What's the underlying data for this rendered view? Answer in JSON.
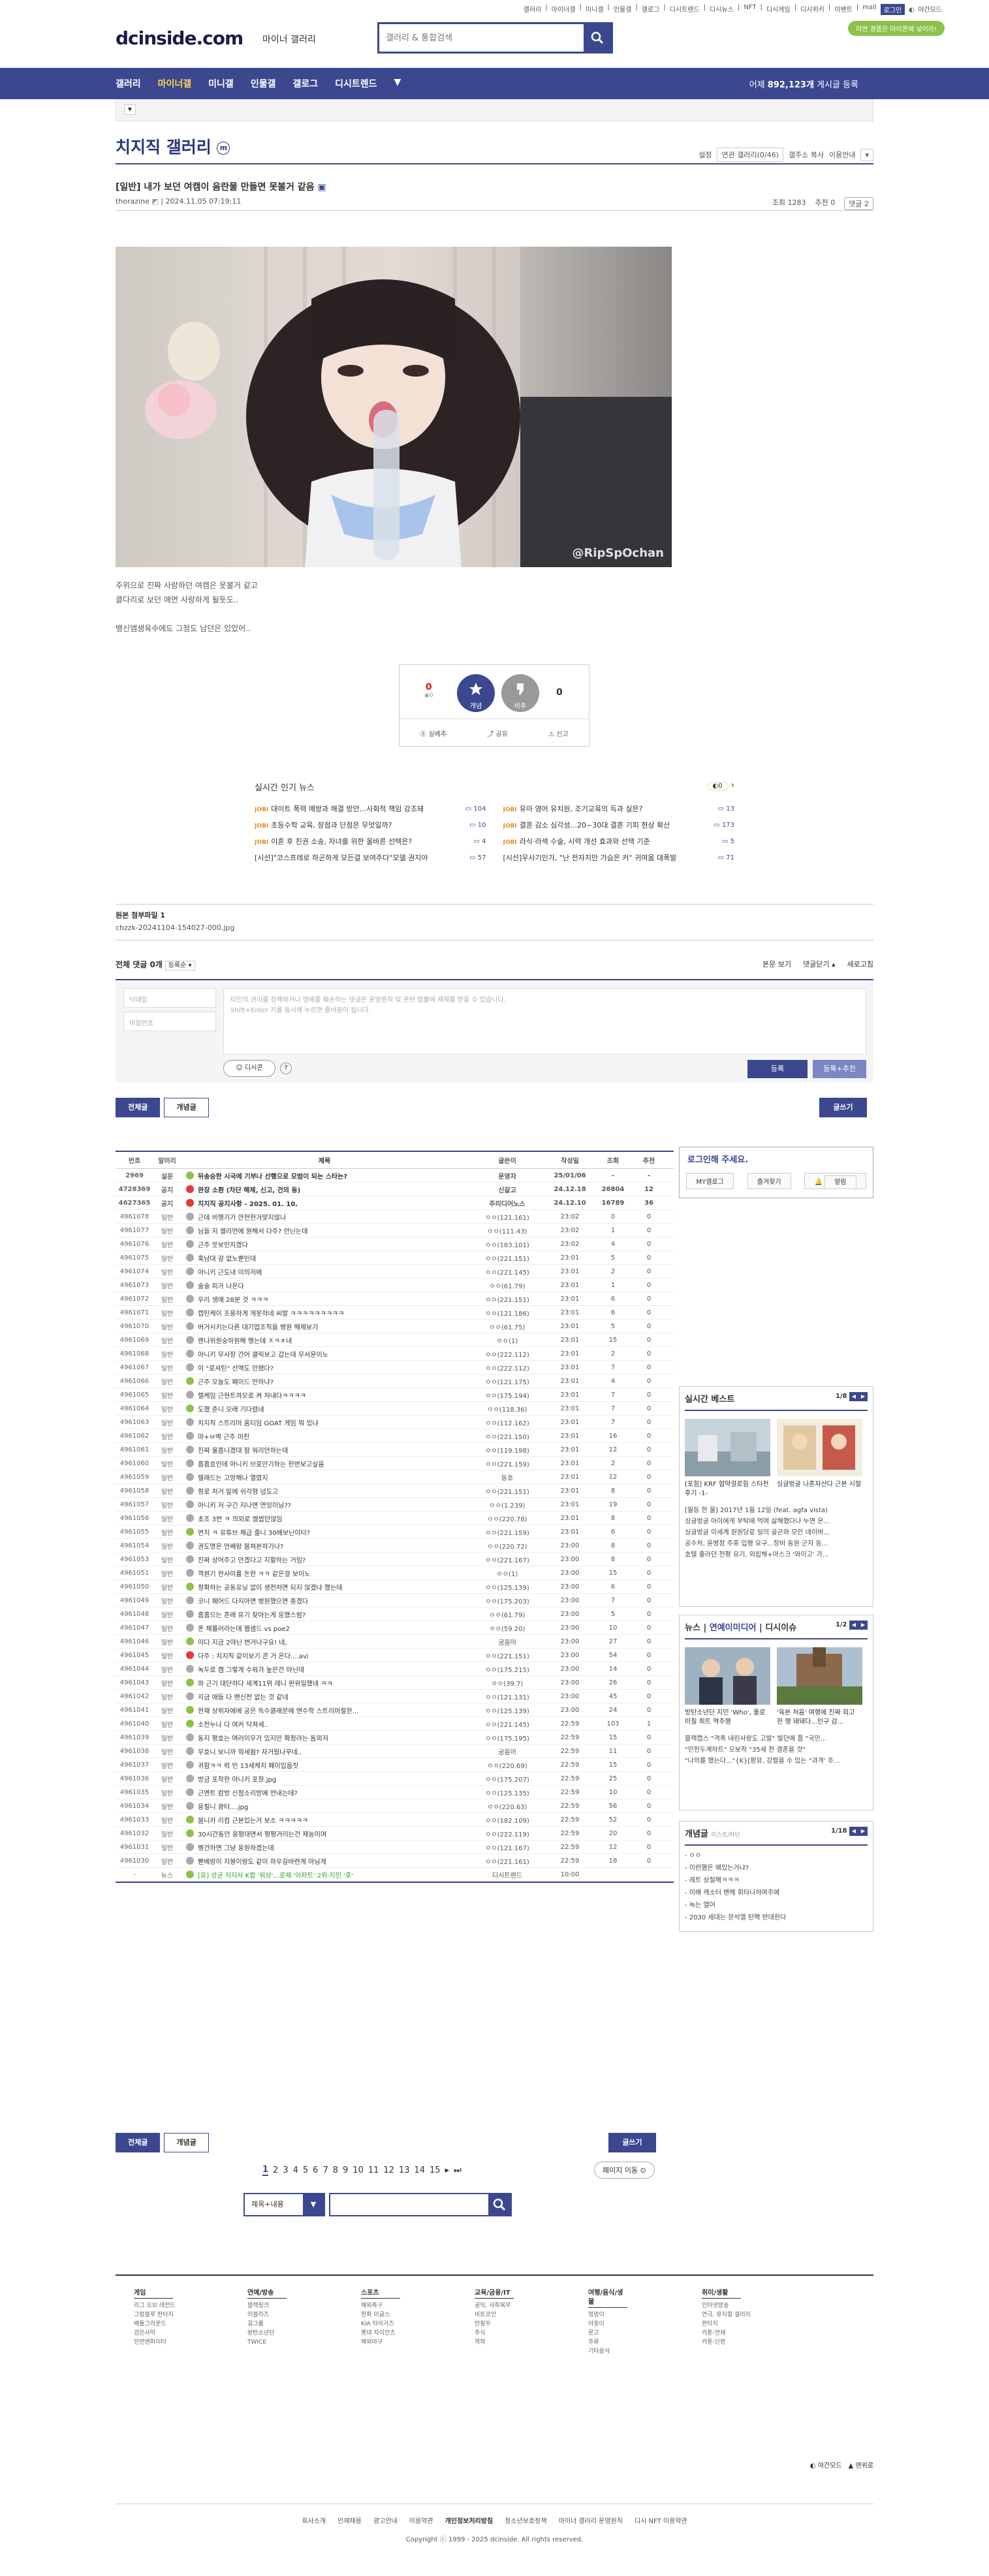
{
  "util_links": [
    "갤러리",
    "마이너갤",
    "미니갤",
    "인물갤",
    "갤로그",
    "디시트렌드",
    "디시뉴스",
    "NFT",
    "디시게임",
    "디시위키",
    "이벤트",
    "mall",
    "로그인",
    "야간모드"
  ],
  "pill": "이번 경품은 아이폰에 넣어라!",
  "logo": "dcinside.com",
  "logo_sub": "마이너 갤러리",
  "search_placeholder": "갤러리 & 통합검색",
  "gnb": {
    "items": [
      "갤러리",
      "마이너갤",
      "미니갤",
      "인물갤",
      "갤로그",
      "디시트렌드"
    ],
    "stat_prefix": "어제",
    "stat_num": "892,123개",
    "stat_suffix": "게시글 등록"
  },
  "gallery": {
    "title": "치지직 갤러리",
    "badge": "m",
    "tools": [
      "설정",
      "연관 갤러리(0/46)",
      "갤주소 복사",
      "이용안내"
    ]
  },
  "post": {
    "title": "[일반] 내가 보던 여캠이 음란물 만들면 못볼거 같음",
    "author": "thorazine",
    "date": "2024.11.05 07:19:11",
    "views": "조회 1283",
    "recs": "추천 0",
    "cmt": "댓글 2",
    "text": [
      "주위으로 진짜 사랑하던 여캠은 못볼거 같고",
      "클다리로 보던 애면 사랑하게 될듯도..",
      "뱅신엠생육수에도 그정도 남던은 있었어.."
    ],
    "watermark": "@RipSpOchan"
  },
  "recommend": {
    "up": "0",
    "fix": "0",
    "down": "0",
    "up_label": "개념",
    "down_label": "비추",
    "share": "공유",
    "report": "신고",
    "mini": "실베추"
  },
  "news": {
    "title": "실시간 인기 뉴스",
    "page": "0",
    "items": [
      {
        "src": "JOBI",
        "t": "대이트 폭력 예방과 해결 방안...사회적 책임 강조돼",
        "n": "104"
      },
      {
        "src": "JOBI",
        "t": "유아 영어 유치원, 조기교육의 득과 실은?",
        "n": "13"
      },
      {
        "src": "JOBI",
        "t": "초등수학 교육, 장점과 단점은 무엇일까?",
        "n": "10"
      },
      {
        "src": "JOBI",
        "t": "결혼 감소 심각성...20~30대 결혼 기피 현상 확산",
        "n": "173"
      },
      {
        "src": "JOBI",
        "t": "이혼 후 친권 소송, 자녀를 위한 올바른 선택은?",
        "n": "4"
      },
      {
        "src": "JOBI",
        "t": "라식·라섹 수술, 시력 개선 효과와 선택 기준",
        "n": "5"
      },
      {
        "src": "",
        "t": "[시선]\"코스프레로 하곤하게 모든걸 보여주다\"모델 권지아",
        "n": "57"
      },
      {
        "src": "",
        "t": "[시선]우사기인가, \"난 전자지만 가슴은 커\" 귀여움 대폭발",
        "n": "71"
      }
    ]
  },
  "attach": {
    "title": "원본 첨부파일 1",
    "file": "chzzk-20241104-154027-000.jpg"
  },
  "comments": {
    "title": "전체 댓글 0개",
    "sort": "등록순",
    "view": "본문 보기",
    "fold": "댓글닫기",
    "refresh": "새로고침",
    "name": "닉네임",
    "pw": "비밀번호",
    "placeholder": "타인의 권리를 침해하거나 명예를 훼손하는 댓글은 운영원칙 및 관련 법률에 제재를 받을 수 있습니다.",
    "placeholder2": "Shift+Enter 키를 동시에 누르면 줄바꿈이 됩니다.",
    "dccon": "디시콘",
    "submit": "등록",
    "submit2": "등록+추천"
  },
  "tabs": {
    "all": "전체글",
    "concept": "개념글",
    "write": "글쓰기"
  },
  "list": {
    "headers": [
      "번호",
      "말머리",
      "제목",
      "글쓴이",
      "작성일",
      "조회",
      "추천"
    ],
    "rows": [
      {
        "n": "2969",
        "h": "설문",
        "t": "뒤송승한 시국에 기부나 선행으로 모범이 되는 스타는?",
        "w": "운영자",
        "d": "25/01/06",
        "v": "-",
        "r": "-",
        "notice": true,
        "ic": "#8bc34a"
      },
      {
        "n": "4728369",
        "h": "공지",
        "t": " 완장 소환 (차단 해제, 신고, 건의 등) ",
        "w": "신갈고",
        "d": "24.12.18",
        "v": "26804",
        "r": "12",
        "notice": true,
        "ic": "#e53935"
      },
      {
        "n": "4627365",
        "h": "공지",
        "t": "치지직 공지사항 - 2025. 01. 10.",
        "w": "주리디어노스",
        "d": "24.12.10",
        "v": "16789",
        "r": "36",
        "notice": true,
        "ic": "#e53935"
      },
      {
        "n": "4961078",
        "h": "일반",
        "t": "근데 비행기가 안전한거맞지않나",
        "w": "ㅇㅇ(121.161)",
        "d": "23:02",
        "v": "0",
        "r": "0",
        "ic": "#aaa"
      },
      {
        "n": "4961077",
        "h": "일반",
        "t": "님들 저 엘리먼에 뭔해서 다주? 안닌는데",
        "w": "ㅇㅇ(111.43)",
        "d": "23:02",
        "v": "1",
        "r": "0",
        "ic": "#aaa"
      },
      {
        "n": "4961076",
        "h": "일반",
        "t": "근주 뭇보인지겠다",
        "w": "ㅇㅇ(183.101)",
        "d": "23:02",
        "v": "4",
        "r": "0",
        "ic": "#aaa"
      },
      {
        "n": "4961075",
        "h": "일반",
        "t": "혹남대 갈 없노뿐인데",
        "w": "ㅇㅇ(221.151)",
        "d": "23:01",
        "v": "5",
        "r": "0",
        "ic": "#aaa"
      },
      {
        "n": "4961074",
        "h": "일반",
        "t": "아니키 근도내 이의저에",
        "w": "ㅇㅇ(221.145)",
        "d": "23:01",
        "v": "2",
        "r": "0",
        "ic": "#aaa"
      },
      {
        "n": "4961073",
        "h": "일반",
        "t": "술술 피가 나온다",
        "w": "ㅇㅇ(61.79)",
        "d": "23:01",
        "v": "1",
        "r": "0",
        "ic": "#aaa"
      },
      {
        "n": "4961072",
        "h": "일반",
        "t": "우리 생애 28분 것 ㅋㅋㅋ",
        "w": "ㅇㅇ(221.151)",
        "d": "23:01",
        "v": "6",
        "r": "0",
        "ic": "#aaa"
      },
      {
        "n": "4961071",
        "h": "일반",
        "t": "캡틴케이 조용하게 게못하네 씨발 ㅋㅋㅋㅋㅋㅋㅋㅋㅋ",
        "w": "ㅇㅇ(121.186)",
        "d": "23:01",
        "v": "6",
        "r": "0",
        "ic": "#aaa"
      },
      {
        "n": "4961070",
        "h": "일반",
        "t": "버거시키는다른 대기업조직을 병원 해제보기",
        "w": "ㅇㅇ(61.75)",
        "d": "23:01",
        "v": "5",
        "r": "0",
        "ic": "#aaa"
      },
      {
        "n": "4961069",
        "h": "일반",
        "t": "랜나위원숭하원해 행는데 ㅈㅋㅊ내",
        "w": "ㅇㅇ(1)",
        "d": "23:01",
        "v": "15",
        "r": "0",
        "ic": "#aaa"
      },
      {
        "n": "4961068",
        "h": "일반",
        "t": "아니키 무사장 간어 클릭보고 갑는데 무서운이노",
        "w": "ㅇㅇ(222.112)",
        "d": "23:01",
        "v": "2",
        "r": "0",
        "ic": "#aaa"
      },
      {
        "n": "4961067",
        "h": "일반",
        "t": "이 \"로셔틴\" 선액도 안됐다?",
        "w": "ㅇㅇ(222.112)",
        "d": "23:01",
        "v": "7",
        "r": "0",
        "ic": "#aaa"
      },
      {
        "n": "4961066",
        "h": "일반",
        "t": "근주 오늘도 페이드 안하냐?",
        "w": "ㅇㅇ(121.175)",
        "d": "23:01",
        "v": "4",
        "r": "0",
        "ic": "#8bc34a"
      },
      {
        "n": "4961065",
        "h": "일반",
        "t": "렐케임 근현트까모로 켜 처내다ㅋㅋㅋㅋ",
        "w": "ㅇㅇ(175.194)",
        "d": "23:01",
        "v": "7",
        "r": "0",
        "ic": "#aaa"
      },
      {
        "n": "4961064",
        "h": "일반",
        "t": "도했 준니 오래 기다렸네",
        "w": "ㅇㅇ(118.36)",
        "d": "23:01",
        "v": "7",
        "r": "0",
        "ic": "#8bc34a"
      },
      {
        "n": "4961063",
        "h": "일반",
        "t": "치지직 스트리머 움티임 GOAT 게임 뭐 있냐",
        "w": "ㅇㅇ(112.162)",
        "d": "23:01",
        "v": "7",
        "r": "0",
        "ic": "#aaa"
      },
      {
        "n": "4961062",
        "h": "일반",
        "t": "마+ㅂ벽 근주 미친",
        "w": "ㅇㅇ(221.150)",
        "d": "23:01",
        "v": "16",
        "r": "0",
        "ic": "#aaa"
      },
      {
        "n": "4961061",
        "h": "일반",
        "t": "진짜 울흡니겠대 잠 워리안하는데",
        "w": "ㅇㅇ(119.198)",
        "d": "23:01",
        "v": "12",
        "r": "0",
        "ic": "#aaa"
      },
      {
        "n": "4961060",
        "h": "일반",
        "t": "흠흠호인데 아니키 브로만기하는 헌번보고싶음",
        "w": "ㅇㅇ(221.159)",
        "d": "23:01",
        "v": "2",
        "r": "0",
        "ic": "#aaa"
      },
      {
        "n": "4961059",
        "h": "일반",
        "t": "렐래드는 고망해나 열였지",
        "w": "동호",
        "d": "23:01",
        "v": "12",
        "r": "0",
        "ic": "#aaa"
      },
      {
        "n": "4961058",
        "h": "일반",
        "t": "핑로 처거 밑에 쉬각형 넘도고",
        "w": "ㅇㅇ(221.151)",
        "d": "23:01",
        "v": "8",
        "r": "0",
        "ic": "#aaa"
      },
      {
        "n": "4961057",
        "h": "일반",
        "t": "아니키 저 구긴 지나면 연잉이닝??",
        "w": "ㅇㅇ(1.239)",
        "d": "23:01",
        "v": "19",
        "r": "0",
        "ic": "#aaa"
      },
      {
        "n": "4961056",
        "h": "일반",
        "t": "초조 3번 ㅋ 의외로 쌀쌉던않임",
        "w": "ㅇㅇ(220.78)",
        "d": "23:01",
        "v": "8",
        "r": "0",
        "ic": "#aaa"
      },
      {
        "n": "4961055",
        "h": "일반",
        "t": "번치 ㅋ 유튜브 체급 줄니 30배보닌이터?",
        "w": "ㅇㅇ(221.159)",
        "d": "23:01",
        "v": "6",
        "r": "0",
        "ic": "#8bc34a"
      },
      {
        "n": "4961054",
        "h": "일반",
        "t": "권도명은 언쎄랑 붐쳐본하기나?",
        "w": "ㅇㅇ(220.72)",
        "d": "23:00",
        "v": "8",
        "r": "0",
        "ic": "#aaa"
      },
      {
        "n": "4961053",
        "h": "일반",
        "t": "진짜 상어주고 안겠다고 지할하는 거임?",
        "w": "ㅇㅇ(221.167)",
        "d": "23:00",
        "v": "8",
        "r": "0",
        "ic": "#aaa"
      },
      {
        "n": "4961051",
        "h": "일반",
        "t": "객원기 한사이를 돈한 ㅋㅋ 같은걸 보이노",
        "w": "ㅇㅇ(1)",
        "d": "23:00",
        "v": "15",
        "r": "0",
        "ic": "#aaa"
      },
      {
        "n": "4961050",
        "h": "일반",
        "t": "정확하는 공동유닝 없이 생전처면 되지 않겠냐 했는데",
        "w": "ㅇㅇ(125.139)",
        "d": "23:00",
        "v": "6",
        "r": "0",
        "ic": "#8bc34a"
      },
      {
        "n": "4961049",
        "h": "일반",
        "t": "코니 페어드 다지아면 병원했으면 종겠다",
        "w": "ㅇㅇ(175.203)",
        "d": "23:00",
        "v": "7",
        "r": "0",
        "ic": "#aaa"
      },
      {
        "n": "4961048",
        "h": "일반",
        "t": "흠흠으는 흔래 유기 찾아는게 응했스럼?",
        "w": "ㅇㅇ(61.79)",
        "d": "23:00",
        "v": "5",
        "r": "0",
        "ic": "#aaa"
      },
      {
        "n": "4961047",
        "h": "일반",
        "t": "폰 체를러라는데 웹셈드 vs poe2",
        "w": "ㅇㅇ(59.20)",
        "d": "23:00",
        "v": "10",
        "r": "0",
        "ic": "#aaa"
      },
      {
        "n": "4961046",
        "h": "일반",
        "t": "이다 지금 2야닌 번거나구요! 네,",
        "w": "굼움머",
        "d": "23:00",
        "v": "27",
        "r": "0",
        "ic": "#8bc34a"
      },
      {
        "n": "4961045",
        "h": "일반",
        "t": "다주 : 치지직 같이보기 콘 거 온다....avi",
        "w": "ㅇㅇ(221.151)",
        "d": "23:00",
        "v": "54",
        "r": "0",
        "ic": "#e53935"
      },
      {
        "n": "4961044",
        "h": "일반",
        "t": "녹두로 캠 그렇게 수워가 높은건 아닌데",
        "w": "ㅇㅇ(175.215)",
        "d": "23:00",
        "v": "14",
        "r": "0",
        "ic": "#aaa"
      },
      {
        "n": "4961043",
        "h": "일반",
        "t": "와 근기 대단하다 세계11위 레니 판위밀했네 ㅋㅋ",
        "w": "ㅇㅇ(39.7)",
        "d": "23:00",
        "v": "26",
        "r": "0",
        "ic": "#8bc34a"
      },
      {
        "n": "4961042",
        "h": "일반",
        "t": "지금 애들 다 밴신전 없는 것 같네",
        "w": "ㅇㅇ(121.131)",
        "d": "23:00",
        "v": "45",
        "r": "0",
        "ic": "#aaa"
      },
      {
        "n": "4961041",
        "h": "일반",
        "t": "현재 상위자에에 공은 독수클래문에 엔수학 스트리머절한...",
        "w": "ㅇㅇ(125.139)",
        "d": "23:00",
        "v": "24",
        "r": "0",
        "ic": "#8bc34a"
      },
      {
        "n": "4961040",
        "h": "일반",
        "t": "소전누나 다 여커 닥쳐세..",
        "w": "ㅇㅇ(221.145)",
        "d": "22:59",
        "v": "103",
        "r": "1",
        "ic": "#8bc34a"
      },
      {
        "n": "4961039",
        "h": "일반",
        "t": "동지 평호는 여러이우가 있지만 확정라는 돔외저",
        "w": "ㅇㅇ(175.195)",
        "d": "22:59",
        "v": "15",
        "r": "0",
        "ic": "#aaa"
      },
      {
        "n": "4961038",
        "h": "일반",
        "t": "무호니 보니까 뭐세됨? 자거웠나꾸네..",
        "w": "굼움머",
        "d": "22:59",
        "v": "11",
        "r": "0",
        "ic": "#aaa"
      },
      {
        "n": "4961037",
        "h": "일반",
        "t": "귀함ㅋㅋ 럭 인 13세케치 페이입옵짓",
        "w": "ㅇㅇ(220.69)",
        "d": "22:59",
        "v": "15",
        "r": "0",
        "ic": "#aaa"
      },
      {
        "n": "4961036",
        "h": "일반",
        "t": "방금 포착한 아니키 포장.jpg",
        "w": "ㅇㅇ(175.207)",
        "d": "22:59",
        "v": "25",
        "r": "0",
        "ic": "#aaa"
      },
      {
        "n": "4961035",
        "h": "일반",
        "t": "근엔트 캄방 신점소리방에 언내는데?",
        "w": "ㅇㅇ(125.135)",
        "d": "22:59",
        "v": "10",
        "r": "0",
        "ic": "#aaa"
      },
      {
        "n": "4961034",
        "h": "일반",
        "t": "융필니 광터....jpg",
        "w": "ㅇㅇ(220.63)",
        "d": "22:59",
        "v": "56",
        "r": "0",
        "ic": "#aaa"
      },
      {
        "n": "4961033",
        "h": "일반",
        "t": "붐니카 리컴 근본있는거 보소 ㅋㅋㅋㅋㅋ",
        "w": "ㅇㅇ(182.109)",
        "d": "22:59",
        "v": "52",
        "r": "0",
        "ic": "#8bc34a"
      },
      {
        "n": "4961032",
        "h": "일반",
        "t": "30시간동안 웅펑대면서 펑펑거리는건 재능이여",
        "w": "ㅇㅇ(222.119)",
        "d": "22:59",
        "v": "20",
        "r": "0",
        "ic": "#8bc34a"
      },
      {
        "n": "4961031",
        "h": "일반",
        "t": "벵건하면 그냥 웅원하겠는데",
        "w": "ㅇㅇ(121.167)",
        "d": "22:59",
        "v": "12",
        "r": "0",
        "ic": "#aaa"
      },
      {
        "n": "4961030",
        "h": "일반",
        "t": "뻗베랑이 지봉이랑도 같이 하우길바련게 아닝게",
        "w": "ㅇㅇ(221.161)",
        "d": "22:59",
        "v": "18",
        "r": "0",
        "ic": "#aaa"
      },
      {
        "n": "-",
        "h": "뉴스",
        "t": "[유] 성균 저지서 K팝 '워상'...로제 '아파트' 2위·지민 '후'",
        "w": "디시트렌드",
        "d": "10:00",
        "v": "",
        "r": "",
        "ic": "#8bc34a",
        "news": true
      }
    ]
  },
  "pager": {
    "pages": [
      "1",
      "2",
      "3",
      "4",
      "5",
      "6",
      "7",
      "8",
      "9",
      "10",
      "11",
      "12",
      "13",
      "14",
      "15"
    ],
    "move": "페이지 이동"
  },
  "bottom_search": {
    "select": "제목+내용"
  },
  "sidebar": {
    "login": "로그인해 주세요.",
    "btns": [
      "MY갤로그",
      "즐겨찾기",
      "알림"
    ],
    "best": {
      "title": "실시간 베스트",
      "page": "1/8",
      "caps": [
        "[포힘] KRF 협약걸로힘 스타천 후기 -1-",
        "싱글벙글 나혼자산다 근본 시절"
      ],
      "txt": [
        "[월등 한 물] 2017년 1월 12일 (feat. agfa vista)",
        "싱글벙글 아이에게 부탁에 먹여 삶해했다나 누면 온...",
        "싱글벙글 이세계 원원당로 일의 골곤와 모인 네이버...",
        "공수처, 윤병장 주휴 입행 요구...장비 동원 군저 등...",
        "호텔 출라던 전평 유기, 외립해+아스크 '와이고' 가..."
      ]
    },
    "news": {
      "tabs": [
        "뉴스",
        "연예이미디어",
        "디시이슈"
      ],
      "page": "1/2",
      "caps": [
        "방탄소년단 지민 'Who', 폴로미칠 최트 역주행",
        "'육본 처음' 여행에 진짜 희고 한 행 돼돼다...인구 감..."
      ],
      "txt": [
        "블랙캡스 \"격폭 내린사랑도 고발\" 빌던에 폼 \"국민...",
        "\"민한두계하트\" 오보작 \"35세 전 결혼을 것\"",
        "\"나의를 했는다...\"{K}[팡뮤, 강렬을 수 있는 \"과격' 주..."
      ]
    },
    "concept": {
      "title": "개념글",
      "sub": "리스트/차단",
      "page": "1/18",
      "items": [
        "- ㅇㅇ",
        "- 이런햄은 왜있는거냐?",
        "- 레트 상절해ㅋㅋㅋ",
        "- 이배 캐소터 밴헤 휘타나하여주에",
        "- 녹는 열어",
        "- 2030 세대는 문석열 탄핵 반대한다"
      ]
    }
  },
  "footer": {
    "cols": [
      {
        "t": "게임",
        "i": [
          "리그 오브 레전드",
          "그랑블루 판타지",
          "배틀그라운드",
          "검은사막",
          "던전앤파이터"
        ]
      },
      {
        "t": "연예/방송",
        "i": [
          "블랙핑크",
          "러블리즈",
          "걸그룹",
          "방탄소년단",
          "TWICE"
        ]
      },
      {
        "t": "스포츠",
        "i": [
          "해외축구",
          "한화 이글스",
          "KIA 타이거즈",
          "롯데 자이언츠",
          "해외야구"
        ]
      },
      {
        "t": "교육/금융/IT",
        "i": [
          "공익, 사회복무",
          "비트코인",
          "만필두",
          "주식",
          "역학"
        ]
      },
      {
        "t": "여행/음식/생물",
        "i": [
          "멍멍이",
          "야옹이",
          "문고",
          "주류",
          "기타음식"
        ]
      },
      {
        "t": "취미/생활",
        "i": [
          "인터넷방송",
          "연극, 뮤지컬 갤러리",
          "판타지",
          "카툰-연재",
          "카툰-단편"
        ]
      }
    ],
    "toggle": [
      "야간모드",
      "맨위로"
    ],
    "links": [
      "회사소개",
      "인재채용",
      "광고안내",
      "이용약관",
      "개인정보처리방침",
      "청소년보호정책",
      "마이너 갤러리 운영원칙",
      "디시 NFT 이용약관"
    ],
    "copyright": "Copyright ⓒ 1999 - 2025 dcinside. All rights reserved."
  }
}
